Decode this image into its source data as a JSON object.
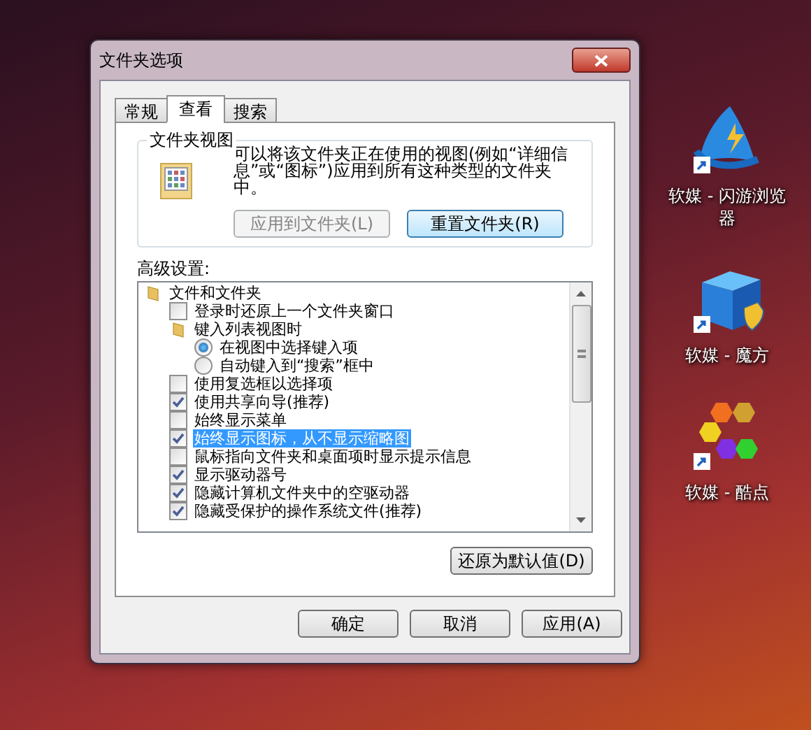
{
  "window": {
    "title": "文件夹选项"
  },
  "tabs": [
    {
      "label": "常规",
      "selected": false
    },
    {
      "label": "查看",
      "selected": true
    },
    {
      "label": "搜索",
      "selected": false
    }
  ],
  "folder_views": {
    "heading": "文件夹视图",
    "description": "可以将该文件夹正在使用的视图(例如“详细信息”或“图标”)应用到所有这种类型的文件夹中。",
    "buttons": [
      {
        "label": "应用到文件夹(L)",
        "disabled": true
      },
      {
        "label": "重置文件夹(R)",
        "disabled": false
      }
    ]
  },
  "advanced": {
    "label": "高级设置:",
    "items": [
      {
        "kind": "folder",
        "label": "文件和文件夹",
        "selected": false,
        "children": [
          {
            "kind": "checkbox",
            "label": "登录时还原上一个文件夹窗口",
            "checked": false,
            "selected": false
          },
          {
            "kind": "folder",
            "label": "键入列表视图时",
            "selected": false,
            "children": [
              {
                "kind": "radio",
                "label": "在视图中选择键入项",
                "checked": true,
                "selected": false
              },
              {
                "kind": "radio",
                "label": "自动键入到“搜索”框中",
                "checked": false,
                "selected": false
              }
            ]
          },
          {
            "kind": "checkbox",
            "label": "使用复选框以选择项",
            "checked": false,
            "selected": false
          },
          {
            "kind": "checkbox",
            "label": "使用共享向导(推荐)",
            "checked": true,
            "selected": false
          },
          {
            "kind": "checkbox",
            "label": "始终显示菜单",
            "checked": false,
            "selected": false
          },
          {
            "kind": "checkbox",
            "label": "始终显示图标，从不显示缩略图",
            "checked": true,
            "selected": true
          },
          {
            "kind": "checkbox",
            "label": "鼠标指向文件夹和桌面项时显示提示信息",
            "checked": false,
            "selected": false
          },
          {
            "kind": "checkbox",
            "label": "显示驱动器号",
            "checked": true,
            "selected": false
          },
          {
            "kind": "checkbox",
            "label": "隐藏计算机文件夹中的空驱动器",
            "checked": true,
            "selected": false
          },
          {
            "kind": "checkbox",
            "label": "隐藏受保护的操作系统文件(推荐)",
            "checked": true,
            "selected": false
          }
        ]
      }
    ],
    "restore_button": "还原为默认值(D)"
  },
  "buttons": [
    "确定",
    "取消",
    "应用(A)"
  ],
  "desktop_icons": [
    {
      "kind": "sail",
      "label": "软媒 - 闪游浏览器"
    },
    {
      "kind": "cube",
      "label": "软媒 - 魔方"
    },
    {
      "kind": "hexagons",
      "label": "软媒 - 酷点"
    }
  ]
}
